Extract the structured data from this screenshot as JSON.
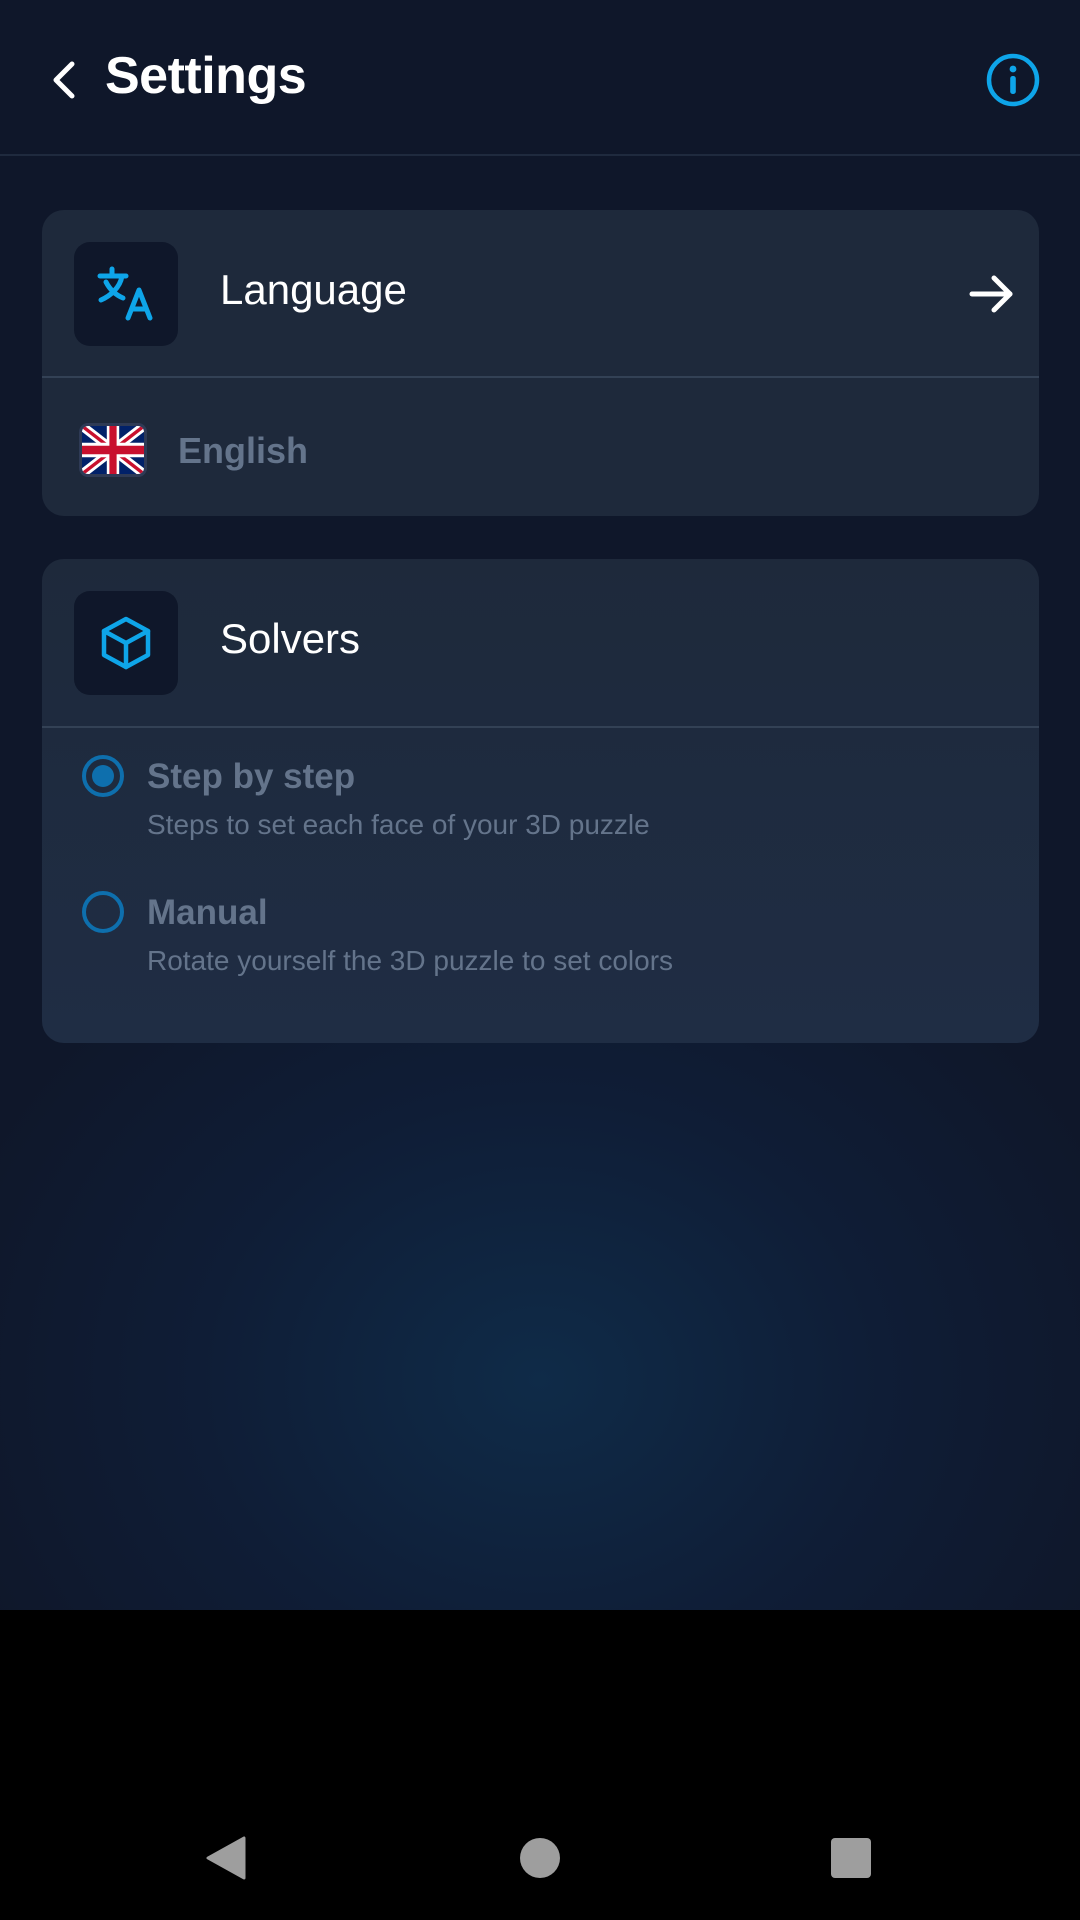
{
  "header": {
    "title": "Settings",
    "back_icon": "chevron-left-icon",
    "info_icon": "info-icon"
  },
  "language_card": {
    "title": "Language",
    "icon": "translate-icon",
    "arrow_icon": "arrow-right-icon",
    "current_language": "English",
    "flag_icon": "uk-flag-icon"
  },
  "solvers_card": {
    "title": "Solvers",
    "icon": "cube-icon",
    "options": [
      {
        "label": "Step by step",
        "description": "Steps to set each face of your 3D puzzle",
        "selected": true
      },
      {
        "label": "Manual",
        "description": "Rotate yourself the 3D puzzle to set colors",
        "selected": false
      }
    ]
  },
  "colors": {
    "accent": "#0ea5e9",
    "background": "#0f172a",
    "card": "#1e293b",
    "muted_text": "#64748b",
    "radio": "#0e6fad"
  },
  "system_nav": {
    "back": "nav-back-icon",
    "home": "nav-home-icon",
    "recents": "nav-recents-icon"
  }
}
